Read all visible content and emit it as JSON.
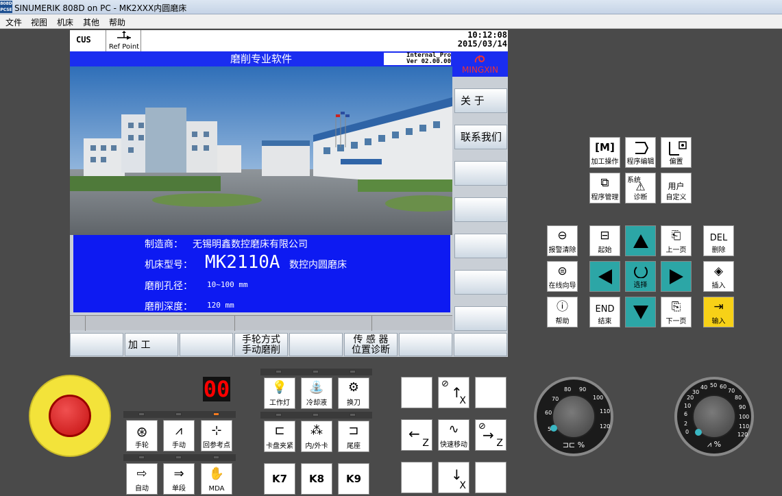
{
  "window": {
    "title": "SINUMERIK 808D on PC - MK2XXX内圆磨床",
    "logo_text": "808D PCSE"
  },
  "menu": [
    "文件",
    "视图",
    "机床",
    "其他",
    "帮助"
  ],
  "hmi": {
    "mode": "CUS",
    "ref_point": "Ref Point",
    "time": "10:12:08",
    "date": "2015/03/14",
    "banner": "磨削专业软件",
    "version_line1": "Internal_Pro",
    "version_line2": "Ver 02.00.00",
    "brand": "MINGXIN",
    "info": {
      "maker_label": "制造商：",
      "maker_value": "无锡明鑫数控磨床有限公司",
      "model_label": "机床型号：",
      "model_value": "MK2110A",
      "model_desc": "数控内圆磨床",
      "bore_label": "磨削孔径：",
      "bore_value": "10~100 mm",
      "depth_label": "磨削深度：",
      "depth_value": "120 mm"
    },
    "vsoft": [
      "关 于",
      "联系我们",
      "",
      "",
      "",
      "",
      "",
      ""
    ],
    "hsoft": [
      "",
      "加    工",
      "",
      "手轮方式\n手动磨削",
      "",
      "传 感 器\n位置诊断",
      "",
      ""
    ]
  },
  "keys": {
    "machining": "加工操作",
    "program_edit": "程序编辑",
    "offset": "偏置",
    "program_mgmt": "程序管理",
    "system_top": "系统",
    "diagnosis": "诊断",
    "user_custom_1": "用户",
    "user_custom_2": "自定义",
    "alarm_clear": "报警清除",
    "start": "起始",
    "page_up": "上一页",
    "del_top": "DEL",
    "delete": "删除",
    "online_guide": "在线向导",
    "select": "选择",
    "insert": "插入",
    "help": "帮助",
    "end_top": "END",
    "end": "结束",
    "page_down": "下一页",
    "input": "输入"
  },
  "machine": {
    "seg_value": "00",
    "worklight": "工作灯",
    "coolant": "冷却液",
    "tool_change": "换刀",
    "handwheel": "手轮",
    "jog": "手动",
    "ref": "回参考点",
    "chuck": "卡盘夹紧",
    "in_out": "内/外卡",
    "tailstock": "尾座",
    "auto": "自动",
    "single": "单段",
    "mda": "MDA",
    "k7": "K7",
    "k8": "K8",
    "k9": "K9",
    "rapid": "快速移动",
    "axis_x": "X",
    "axis_z": "Z"
  },
  "dials": {
    "feed_ticks": [
      "50",
      "60",
      "70",
      "80",
      "90",
      "100",
      "110",
      "120"
    ],
    "feed_unit": "%",
    "spindle_ticks": [
      "0",
      "2",
      "6",
      "10",
      "20",
      "30",
      "40",
      "50",
      "60",
      "70",
      "80",
      "90",
      "100",
      "110",
      "120"
    ],
    "spindle_unit": "%"
  }
}
